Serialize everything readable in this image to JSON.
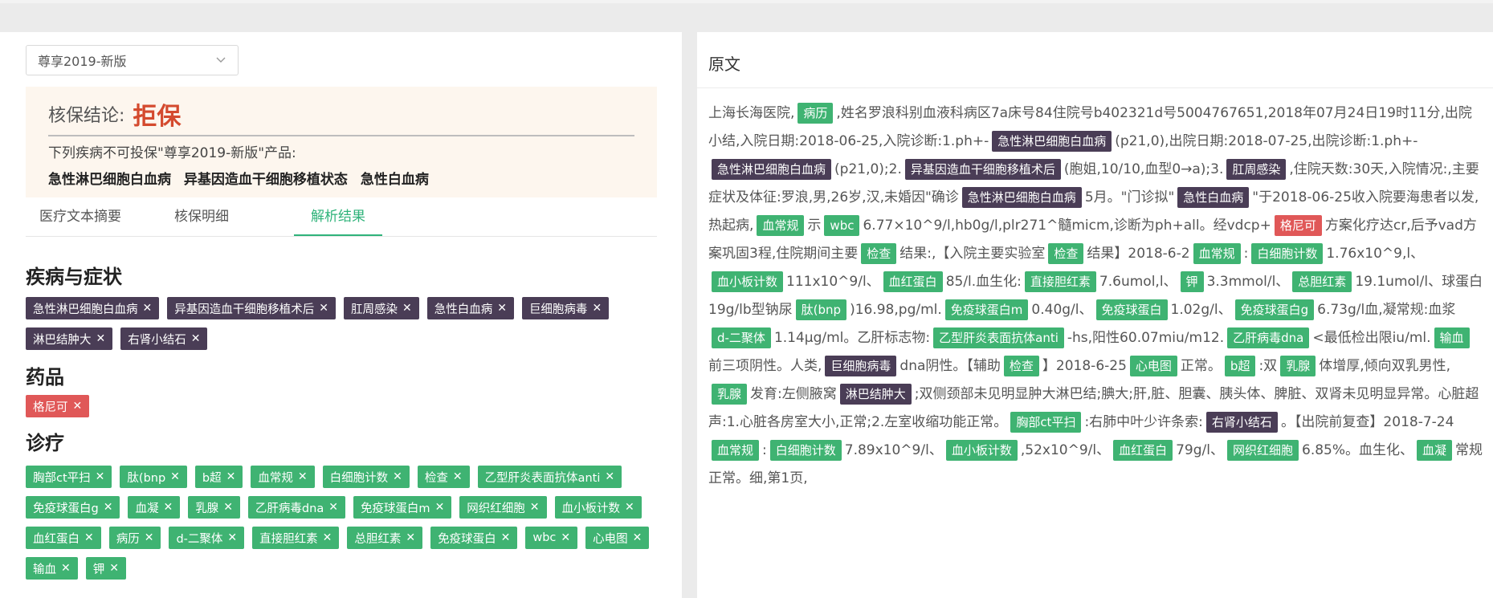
{
  "product_select": {
    "value": "尊享2019-新版"
  },
  "verdict": {
    "label": "核保结论:",
    "value": "拒保",
    "notice": "下列疾病不可投保\"尊享2019-新版\"产品:",
    "diseases": [
      "急性淋巴细胞白血病",
      "异基因造血干细胞移植状态",
      "急性白血病"
    ]
  },
  "tabs": [
    "医疗文本摘要",
    "核保明细",
    "解析结果"
  ],
  "sections": {
    "disease_title": "疾病与症状",
    "drug_title": "药品",
    "treat_title": "诊疗"
  },
  "disease_tags": [
    "急性淋巴细胞白血病",
    "异基因造血干细胞移植术后",
    "肛周感染",
    "急性白血病",
    "巨细胞病毒",
    "淋巴结肿大",
    "右肾小结石"
  ],
  "drug_tags": [
    "格尼可"
  ],
  "treat_tags": [
    "胸部ct平扫",
    "肽(bnp",
    "b超",
    "血常规",
    "白细胞计数",
    "检查",
    "乙型肝炎表面抗体anti",
    "免疫球蛋白g",
    "血凝",
    "乳腺",
    "乙肝病毒dna",
    "免疫球蛋白m",
    "网织红细胞",
    "血小板计数",
    "血红蛋白",
    "病历",
    "d-二聚体",
    "直接胆红素",
    "总胆红素",
    "免疫球蛋白",
    "wbc",
    "心电图",
    "输血",
    "钾"
  ],
  "original": {
    "title": "原文",
    "segments": [
      {
        "t": "上海长海医院,"
      },
      {
        "tag": "病历",
        "c": "g"
      },
      {
        "t": ",姓名罗浪科别血液科病区7a床号84住院号b402321d号5004767651,2018年07月24日19时11分,出院小结,入院日期:2018-06-25,入院诊断:1.ph+-"
      },
      {
        "tag": "急性淋巴细胞白血病",
        "c": "d"
      },
      {
        "t": "(p21,0),出院日期:2018-07-25,出院诊断:1.ph+-"
      },
      {
        "tag": "急性淋巴细胞白血病",
        "c": "d"
      },
      {
        "t": "(p21,0);2."
      },
      {
        "tag": "异基因造血干细胞移植术后",
        "c": "d"
      },
      {
        "t": "(胞姐,10/10,血型0→a);3."
      },
      {
        "tag": "肛周感染",
        "c": "d"
      },
      {
        "t": ",住院天数:30天,入院情况:,主要症状及体征:罗浪,男,26岁,汉,未婚因\"确诊"
      },
      {
        "tag": "急性淋巴细胞白血病",
        "c": "d"
      },
      {
        "t": "5月。\"门诊拟\""
      },
      {
        "tag": "急性白血病",
        "c": "d"
      },
      {
        "t": "\"于2018-06-25收入院要海患者以发,热起病,"
      },
      {
        "tag": "血常规",
        "c": "g"
      },
      {
        "t": "示"
      },
      {
        "tag": "wbc",
        "c": "g"
      },
      {
        "t": "6.77×10^9/l,hb0g/l,plr271^髓micm,诊断为ph+all。经vdcp+"
      },
      {
        "tag": "格尼可",
        "c": "r"
      },
      {
        "t": "方案化疗达cr,后予vad方案巩固3程,住院期间主要"
      },
      {
        "tag": "检查",
        "c": "g"
      },
      {
        "t": "结果:,【入院主要实验室"
      },
      {
        "tag": "检查",
        "c": "g"
      },
      {
        "t": "结果】2018-6-2"
      },
      {
        "tag": "血常规",
        "c": "g"
      },
      {
        "t": ":"
      },
      {
        "tag": "白细胞计数",
        "c": "g"
      },
      {
        "t": "1.76x10^9,l、"
      },
      {
        "tag": "血小板计数",
        "c": "g"
      },
      {
        "t": "111x10^9/l、"
      },
      {
        "tag": "血红蛋白",
        "c": "g"
      },
      {
        "t": "85/l.血生化:"
      },
      {
        "tag": "直接胆红素",
        "c": "g"
      },
      {
        "t": "7.6umol,l、"
      },
      {
        "tag": "钾",
        "c": "g"
      },
      {
        "t": "3.3mmol/l、"
      },
      {
        "tag": "总胆红素",
        "c": "g"
      },
      {
        "t": "19.1umol/l、球蛋白19g/lb型钠尿"
      },
      {
        "tag": "肽(bnp",
        "c": "g"
      },
      {
        "t": ")16.98,pg/ml."
      },
      {
        "tag": "免疫球蛋白m",
        "c": "g"
      },
      {
        "t": "0.40g/l、"
      },
      {
        "tag": "免疫球蛋白",
        "c": "g"
      },
      {
        "t": "1.02g/l、"
      },
      {
        "tag": "免疫球蛋白g",
        "c": "g"
      },
      {
        "t": "6.73g/l血,凝常规:血浆"
      },
      {
        "tag": "d-二聚体",
        "c": "g"
      },
      {
        "t": "1.14μg/ml。乙肝标志物:"
      },
      {
        "tag": "乙型肝炎表面抗体anti",
        "c": "g"
      },
      {
        "t": "-hs,阳性60.07miu/m12."
      },
      {
        "tag": "乙肝病毒dna",
        "c": "g"
      },
      {
        "t": "<最低检出限iu/ml."
      },
      {
        "tag": "输血",
        "c": "g"
      },
      {
        "t": "前三项阴性。人类,"
      },
      {
        "tag": "巨细胞病毒",
        "c": "d"
      },
      {
        "t": "dna阴性。【辅助"
      },
      {
        "tag": "检查",
        "c": "g"
      },
      {
        "t": "】2018-6-25"
      },
      {
        "tag": "心电图",
        "c": "g"
      },
      {
        "t": "正常。"
      },
      {
        "tag": "b超",
        "c": "g"
      },
      {
        "t": ":双"
      },
      {
        "tag": "乳腺",
        "c": "g"
      },
      {
        "t": "体增厚,倾向双乳男性,"
      },
      {
        "tag": "乳腺",
        "c": "g"
      },
      {
        "t": "发育:左侧腋窝"
      },
      {
        "tag": "淋巴结肿大",
        "c": "d"
      },
      {
        "t": ";双侧颈部未见明显肿大淋巴结;腆大;肝,脏、胆囊、胰头体、脾脏、双肾未见明显异常。心脏超声:1.心脏各房室大小,正常;2.左室收缩功能正常。"
      },
      {
        "tag": "胸部ct平扫",
        "c": "g"
      },
      {
        "t": ":右肺中叶少许条索:"
      },
      {
        "tag": "右肾小结石",
        "c": "d"
      },
      {
        "t": "。【出院前复查】2018-7-24"
      },
      {
        "tag": "血常规",
        "c": "g"
      },
      {
        "t": ":"
      },
      {
        "tag": "白细胞计数",
        "c": "g"
      },
      {
        "t": "7.89x10^9/l、"
      },
      {
        "tag": "血小板计数",
        "c": "g"
      },
      {
        "t": ",52x10^9/l、"
      },
      {
        "tag": "血红蛋白",
        "c": "g"
      },
      {
        "t": "79g/l、"
      },
      {
        "tag": "网织红细胞",
        "c": "g"
      },
      {
        "t": "6.85%。血生化、"
      },
      {
        "tag": "血凝",
        "c": "g"
      },
      {
        "t": "常规正常。细,第1页,"
      }
    ]
  },
  "colors": {
    "accent": "#2fb37a",
    "reject": "#d44a2e",
    "disease": "#4a3d56",
    "drug": "#e05858",
    "treat": "#3fb372"
  },
  "icons": {
    "select": "chevron-down-icon",
    "remove": "close-icon"
  }
}
